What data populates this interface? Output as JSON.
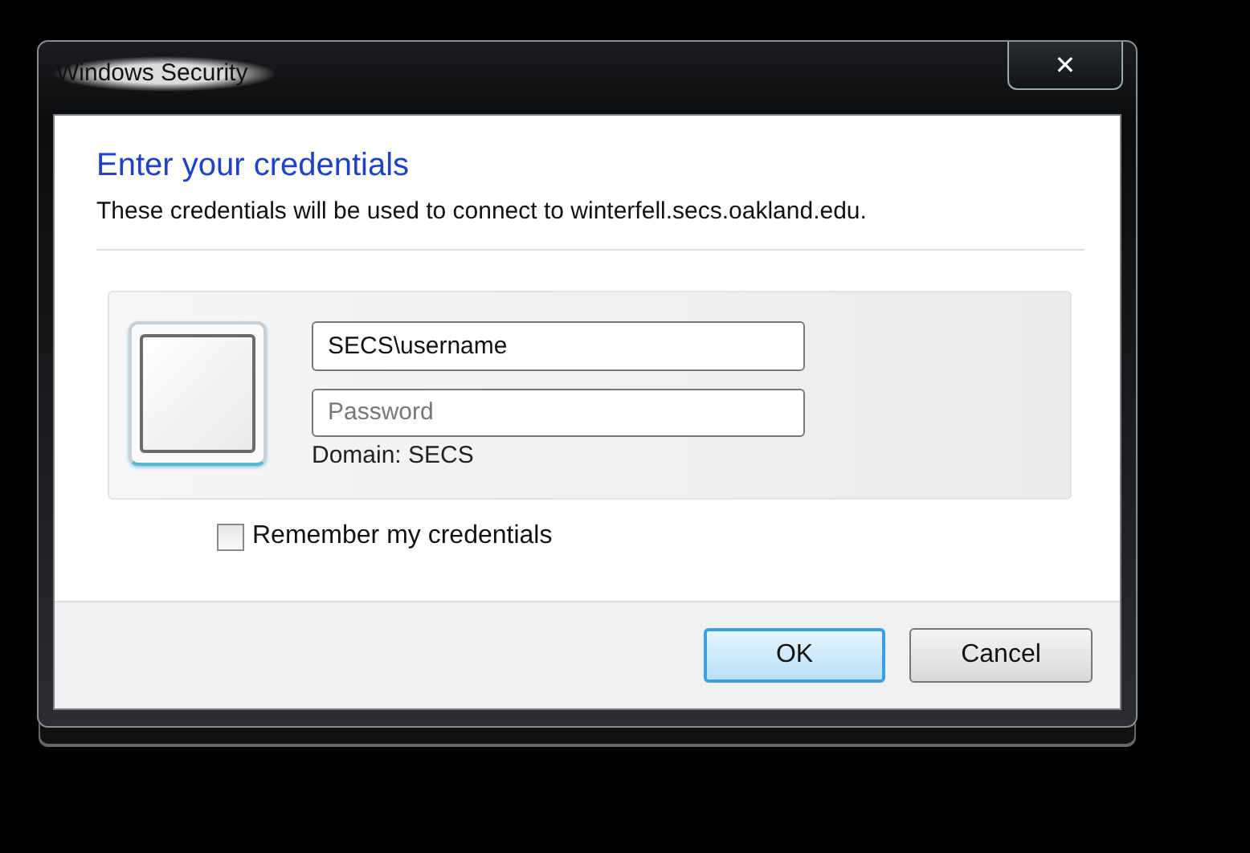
{
  "window": {
    "title": "Windows Security",
    "close_button": "✕"
  },
  "heading": "Enter your credentials",
  "description": "These credentials will be used to connect to winterfell.secs.oakland.edu.",
  "credentials": {
    "username": "SECS\\username",
    "password_placeholder": "Password",
    "domain": "Domain: SECS"
  },
  "remember": {
    "label": "Remember my credentials",
    "checked": false
  },
  "buttons": [
    {
      "label": "OK",
      "default": true
    },
    {
      "label": "Cancel",
      "default": false
    }
  ]
}
